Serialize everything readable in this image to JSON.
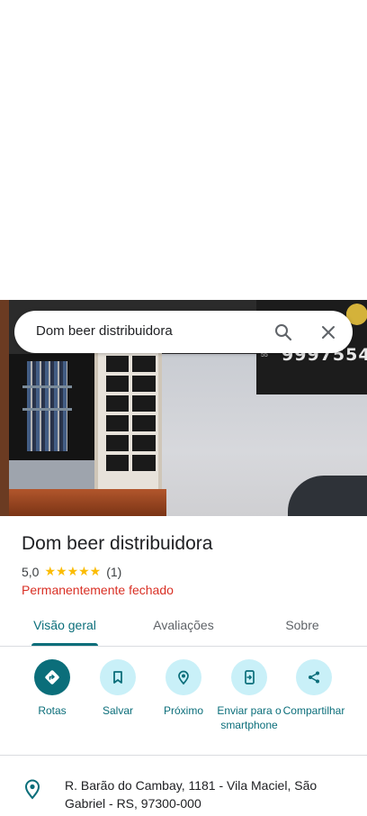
{
  "search": {
    "query": "Dom beer distribuidora"
  },
  "place": {
    "name": "Dom beer distribuidora",
    "rating": "5,0",
    "stars": "★★★★★",
    "review_count": "(1)",
    "status": "Permanentemente fechado",
    "banner_text": "9997554",
    "banner_prefix": "55"
  },
  "tabs": [
    {
      "label": "Visão geral",
      "active": true
    },
    {
      "label": "Avaliações",
      "active": false
    },
    {
      "label": "Sobre",
      "active": false
    }
  ],
  "actions": [
    {
      "label": "Rotas",
      "icon": "directions-icon"
    },
    {
      "label": "Salvar",
      "icon": "bookmark-icon"
    },
    {
      "label": "Próximo",
      "icon": "nearby-icon"
    },
    {
      "label": "Enviar para o smartphone",
      "icon": "send-to-phone-icon"
    },
    {
      "label": "Compartilhar",
      "icon": "share-icon"
    }
  ],
  "address": {
    "text": "R. Barão do Cambay, 1181 - Vila Maciel, São Gabriel - RS, 97300-000",
    "icon": "location-pin-icon"
  },
  "colors": {
    "accent": "#0b6e7a",
    "accent_light": "#c9f0f8",
    "closed": "#d93025",
    "star": "#fbbc04"
  }
}
